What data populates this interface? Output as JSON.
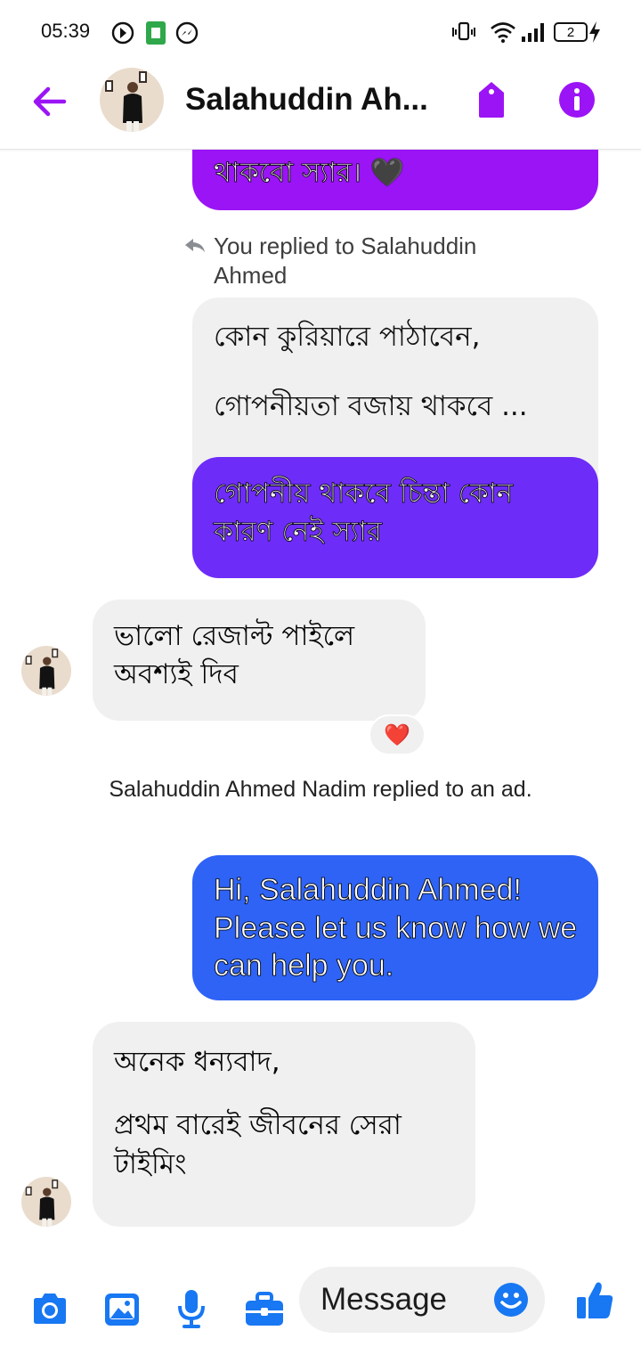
{
  "status_bar": {
    "time": "05:39",
    "battery": "2"
  },
  "header": {
    "contact_name": "Salahuddin Ah..."
  },
  "messages": [
    {
      "type": "outgoing",
      "text": "থাকবো স্যার। 🖤",
      "color": "#9a14f5"
    },
    {
      "type": "reply_note",
      "text": "You replied to Salahuddin Ahmed"
    },
    {
      "type": "quoted",
      "line1": "কোন কুরিয়ারে পাঠাবেন,",
      "line2": "গোপনীয়তা বজায় থাকবে ..."
    },
    {
      "type": "outgoing",
      "text": "গোপনীয় থাকবে চিন্তা কোন কারণ নেই স্যার",
      "color": "#6e2cf8"
    },
    {
      "type": "incoming",
      "text": "ভালো রেজাল্ট পাইলে অবশ্যই দিব",
      "reaction": "❤️"
    },
    {
      "type": "system",
      "text": "Salahuddin Ahmed Nadim replied to an ad."
    },
    {
      "type": "outgoing",
      "text": "Hi, Salahuddin Ahmed! Please let us know how we can help you.",
      "color": "#2e63f5"
    },
    {
      "type": "incoming",
      "line1": "অনেক ধন্যবাদ,",
      "line2": "প্রথম বারেই জীবনের সেরা টাইমিং"
    }
  ],
  "composer": {
    "placeholder": "Message"
  },
  "colors": {
    "accent": "#9b14f5",
    "composer_blue": "#1877f2",
    "bubble_in": "#f0f0f0"
  },
  "icons": [
    "back-arrow-icon",
    "tag-icon",
    "info-icon",
    "camera-icon",
    "gallery-icon",
    "microphone-icon",
    "briefcase-icon",
    "emoji-icon",
    "thumbs-up-icon",
    "reply-arrow-icon"
  ]
}
